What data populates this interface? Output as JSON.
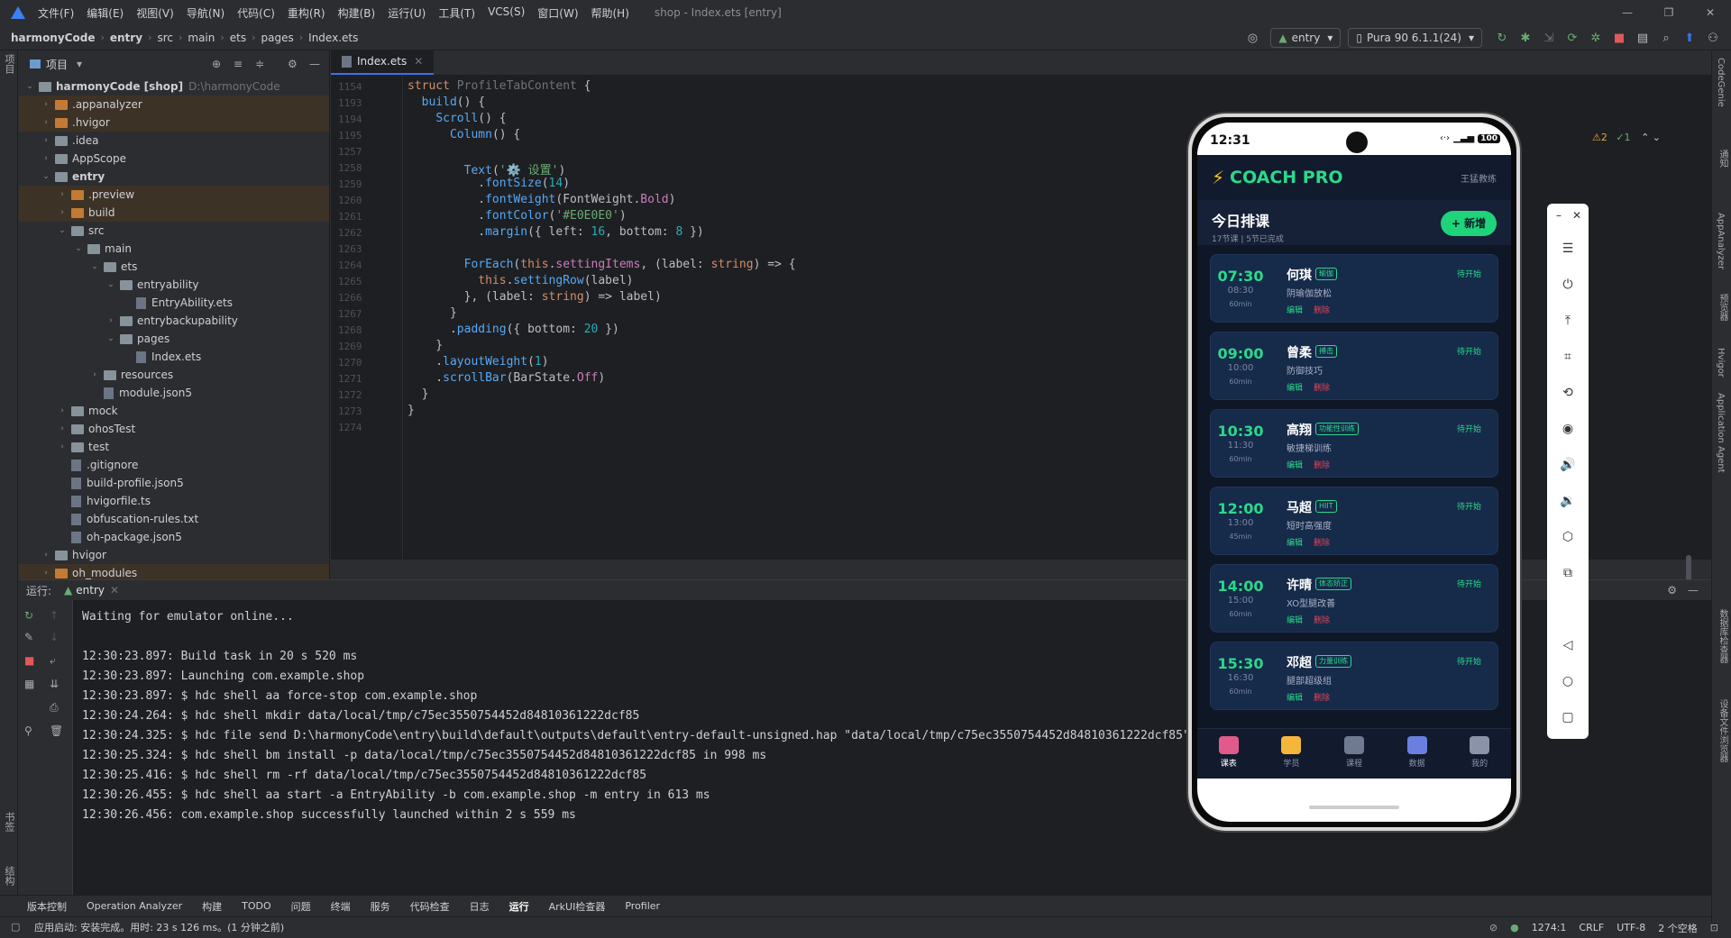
{
  "menu": {
    "items": [
      "文件(F)",
      "编辑(E)",
      "视图(V)",
      "导航(N)",
      "代码(C)",
      "重构(R)",
      "构建(B)",
      "运行(U)",
      "工具(T)",
      "VCS(S)",
      "窗口(W)",
      "帮助(H)"
    ],
    "window_title": "shop - Index.ets [entry]"
  },
  "nav": {
    "breadcrumbs": [
      "harmonyCode",
      "entry",
      "src",
      "main",
      "ets",
      "pages",
      "Index.ets"
    ],
    "run_config": "entry",
    "device": "Pura 90 6.1.1(24)"
  },
  "project": {
    "title": "项目",
    "root_name": "harmonyCode [shop]",
    "root_path": "D:\\harmonyCode",
    "tree": [
      {
        "label": ".appanalyzer",
        "depth": 1,
        "type": "folder-orange",
        "chev": "›",
        "sel": true
      },
      {
        "label": ".hvigor",
        "depth": 1,
        "type": "folder-orange",
        "chev": "›",
        "sel": true
      },
      {
        "label": ".idea",
        "depth": 1,
        "type": "folder",
        "chev": "›",
        "sel": false
      },
      {
        "label": "AppScope",
        "depth": 1,
        "type": "folder",
        "chev": "›",
        "sel": false
      },
      {
        "label": "entry",
        "depth": 1,
        "type": "folder",
        "chev": "⌄",
        "sel": false,
        "bold": true
      },
      {
        "label": ".preview",
        "depth": 2,
        "type": "folder-orange",
        "chev": "›",
        "sel": true
      },
      {
        "label": "build",
        "depth": 2,
        "type": "folder-orange",
        "chev": "›",
        "sel": true
      },
      {
        "label": "src",
        "depth": 2,
        "type": "folder",
        "chev": "⌄",
        "sel": false
      },
      {
        "label": "main",
        "depth": 3,
        "type": "folder",
        "chev": "⌄",
        "sel": false
      },
      {
        "label": "ets",
        "depth": 4,
        "type": "folder",
        "chev": "⌄",
        "sel": false
      },
      {
        "label": "entryability",
        "depth": 5,
        "type": "folder",
        "chev": "⌄",
        "sel": false
      },
      {
        "label": "EntryAbility.ets",
        "depth": 6,
        "type": "file",
        "chev": "",
        "sel": false
      },
      {
        "label": "entrybackupability",
        "depth": 5,
        "type": "folder",
        "chev": "›",
        "sel": false
      },
      {
        "label": "pages",
        "depth": 5,
        "type": "folder",
        "chev": "⌄",
        "sel": false
      },
      {
        "label": "Index.ets",
        "depth": 6,
        "type": "file",
        "chev": "",
        "sel": false
      },
      {
        "label": "resources",
        "depth": 4,
        "type": "folder",
        "chev": "›",
        "sel": false
      },
      {
        "label": "module.json5",
        "depth": 4,
        "type": "file",
        "chev": "",
        "sel": false
      },
      {
        "label": "mock",
        "depth": 2,
        "type": "folder",
        "chev": "›",
        "sel": false
      },
      {
        "label": "ohosTest",
        "depth": 2,
        "type": "folder",
        "chev": "›",
        "sel": false
      },
      {
        "label": "test",
        "depth": 2,
        "type": "folder",
        "chev": "›",
        "sel": false
      },
      {
        "label": ".gitignore",
        "depth": 2,
        "type": "file",
        "chev": "",
        "sel": false
      },
      {
        "label": "build-profile.json5",
        "depth": 2,
        "type": "file",
        "chev": "",
        "sel": false
      },
      {
        "label": "hvigorfile.ts",
        "depth": 2,
        "type": "file",
        "chev": "",
        "sel": false
      },
      {
        "label": "obfuscation-rules.txt",
        "depth": 2,
        "type": "file",
        "chev": "",
        "sel": false
      },
      {
        "label": "oh-package.json5",
        "depth": 2,
        "type": "file",
        "chev": "",
        "sel": false
      },
      {
        "label": "hvigor",
        "depth": 1,
        "type": "folder",
        "chev": "›",
        "sel": false
      },
      {
        "label": "oh_modules",
        "depth": 1,
        "type": "folder-orange",
        "chev": "›",
        "sel": true
      }
    ]
  },
  "editor": {
    "tab": "Index.ets",
    "warnings": "⚠2",
    "checks": "✓1",
    "lines": [
      {
        "n": "1154",
        "html": "<span class='kw'>struct</span> <span class='ty'>ProfileTabContent</span> {"
      },
      {
        "n": "1193",
        "html": "  <span class='fn'>build</span>() {"
      },
      {
        "n": "1194",
        "html": "    <span class='fn'>Scroll</span>() {"
      },
      {
        "n": "1195",
        "html": "      <span class='fn'>Column</span>() {"
      },
      {
        "n": "1257",
        "html": ""
      },
      {
        "n": "1258",
        "html": "        <span class='fn'>Text</span>(<span class='str'>'⚙️ 设置'</span>)"
      },
      {
        "n": "1259",
        "html": "          .<span class='fn'>fontSize</span>(<span class='num'>14</span>)"
      },
      {
        "n": "1260",
        "html": "          .<span class='fn'>fontWeight</span>(FontWeight.<span class='prop'>Bold</span>)"
      },
      {
        "n": "1261",
        "html": "          .<span class='fn'>fontColor</span>(<span class='str'>'#E0E0E0'</span>)"
      },
      {
        "n": "1262",
        "html": "          .<span class='fn'>margin</span>({ left: <span class='num'>16</span>, bottom: <span class='num'>8</span> })"
      },
      {
        "n": "1263",
        "html": ""
      },
      {
        "n": "1264",
        "html": "        <span class='fn'>ForEach</span>(<span class='kw'>this</span>.<span class='prop'>settingItems</span>, (label: <span class='kw'>string</span>) => {"
      },
      {
        "n": "1265",
        "html": "          <span class='kw'>this</span>.<span class='fn'>settingRow</span>(label)"
      },
      {
        "n": "1266",
        "html": "        }, (label: <span class='kw'>string</span>) => label)"
      },
      {
        "n": "1267",
        "html": "      }"
      },
      {
        "n": "1268",
        "html": "      .<span class='fn'>padding</span>({ bottom: <span class='num'>20</span> })"
      },
      {
        "n": "1269",
        "html": "    }"
      },
      {
        "n": "1270",
        "html": "    .<span class='fn'>layoutWeight</span>(<span class='num'>1</span>)"
      },
      {
        "n": "1271",
        "html": "    .<span class='fn'>scrollBar</span>(BarState.<span class='prop'>Off</span>)"
      },
      {
        "n": "1272",
        "html": "  }"
      },
      {
        "n": "1273",
        "html": "}"
      },
      {
        "n": "1274",
        "html": ""
      }
    ]
  },
  "run": {
    "label": "运行:",
    "tab": "entry",
    "console": [
      "Waiting for emulator online...",
      "",
      "12:30:23.897: Build task in 20 s 520 ms",
      "12:30:23.897: Launching com.example.shop",
      "12:30:23.897: $ hdc shell aa force-stop com.example.shop",
      "12:30:24.264: $ hdc shell mkdir data/local/tmp/c75ec3550754452d84810361222dcf85",
      "12:30:24.325: $ hdc file send D:\\harmonyCode\\entry\\build\\default\\outputs\\default\\entry-default-unsigned.hap \"data/local/tmp/c75ec3550754452d84810361222dcf85\"",
      "12:30:25.324: $ hdc shell bm install -p data/local/tmp/c75ec3550754452d84810361222dcf85 in 998 ms",
      "12:30:25.416: $ hdc shell rm -rf data/local/tmp/c75ec3550754452d84810361222dcf85",
      "12:30:26.455: $ hdc shell aa start -a EntryAbility -b com.example.shop -m entry in 613 ms",
      "12:30:26.456: com.example.shop successfully launched within 2 s 559 ms"
    ]
  },
  "toolwindows": [
    "版本控制",
    "Operation Analyzer",
    "构建",
    "TODO",
    "问题",
    "终端",
    "服务",
    "代码检查",
    "日志",
    "运行",
    "ArkUI检查器",
    "Profiler"
  ],
  "status": {
    "message": "应用启动: 安装完成。用时: 23 s 126 ms。(1 分钟之前)",
    "position": "1274:1",
    "line_sep": "CRLF",
    "encoding": "UTF-8",
    "indent": "2 个空格"
  },
  "left_strip": [
    "项目",
    "书签",
    "结构"
  ],
  "right_strip": [
    "CodeGenie",
    "通知",
    "AppAnalyzer",
    "预览器",
    "Hvigor",
    "Application Agent",
    "数据库检查器",
    "设备文件浏览器"
  ],
  "phone": {
    "time": "12:31",
    "battery": "100",
    "brand": "COACH PRO",
    "coach": "王猛教练",
    "schedule_title": "今日排课",
    "schedule_sub": "17节课 | 5节已完成",
    "add_label": "+ 新增",
    "edit_label": "编辑",
    "delete_label": "删除",
    "status_label": "待开始",
    "cards": [
      {
        "start": "07:30",
        "end": "08:30",
        "dur": "60min",
        "name": "何琪",
        "tag": "瑜伽",
        "course": "阴瑜伽放松"
      },
      {
        "start": "09:00",
        "end": "10:00",
        "dur": "60min",
        "name": "曾柔",
        "tag": "搏击",
        "course": "防御技巧"
      },
      {
        "start": "10:30",
        "end": "11:30",
        "dur": "60min",
        "name": "高翔",
        "tag": "功能性训练",
        "course": "敏捷梯训练"
      },
      {
        "start": "12:00",
        "end": "13:00",
        "dur": "45min",
        "name": "马超",
        "tag": "HIIT",
        "course": "短时高强度"
      },
      {
        "start": "14:00",
        "end": "15:00",
        "dur": "60min",
        "name": "许晴",
        "tag": "体态矫正",
        "course": "XO型腿改善"
      },
      {
        "start": "15:30",
        "end": "16:30",
        "dur": "60min",
        "name": "邓超",
        "tag": "力量训练",
        "course": "腿部超级组"
      }
    ],
    "nav": [
      {
        "label": "课表",
        "color": "#e05a8a",
        "active": true
      },
      {
        "label": "学员",
        "color": "#f5b73b",
        "active": false
      },
      {
        "label": "课程",
        "color": "#6f7a90",
        "active": false
      },
      {
        "label": "数据",
        "color": "#6b7fe0",
        "active": false
      },
      {
        "label": "我的",
        "color": "#8a93a8",
        "active": false
      }
    ]
  }
}
